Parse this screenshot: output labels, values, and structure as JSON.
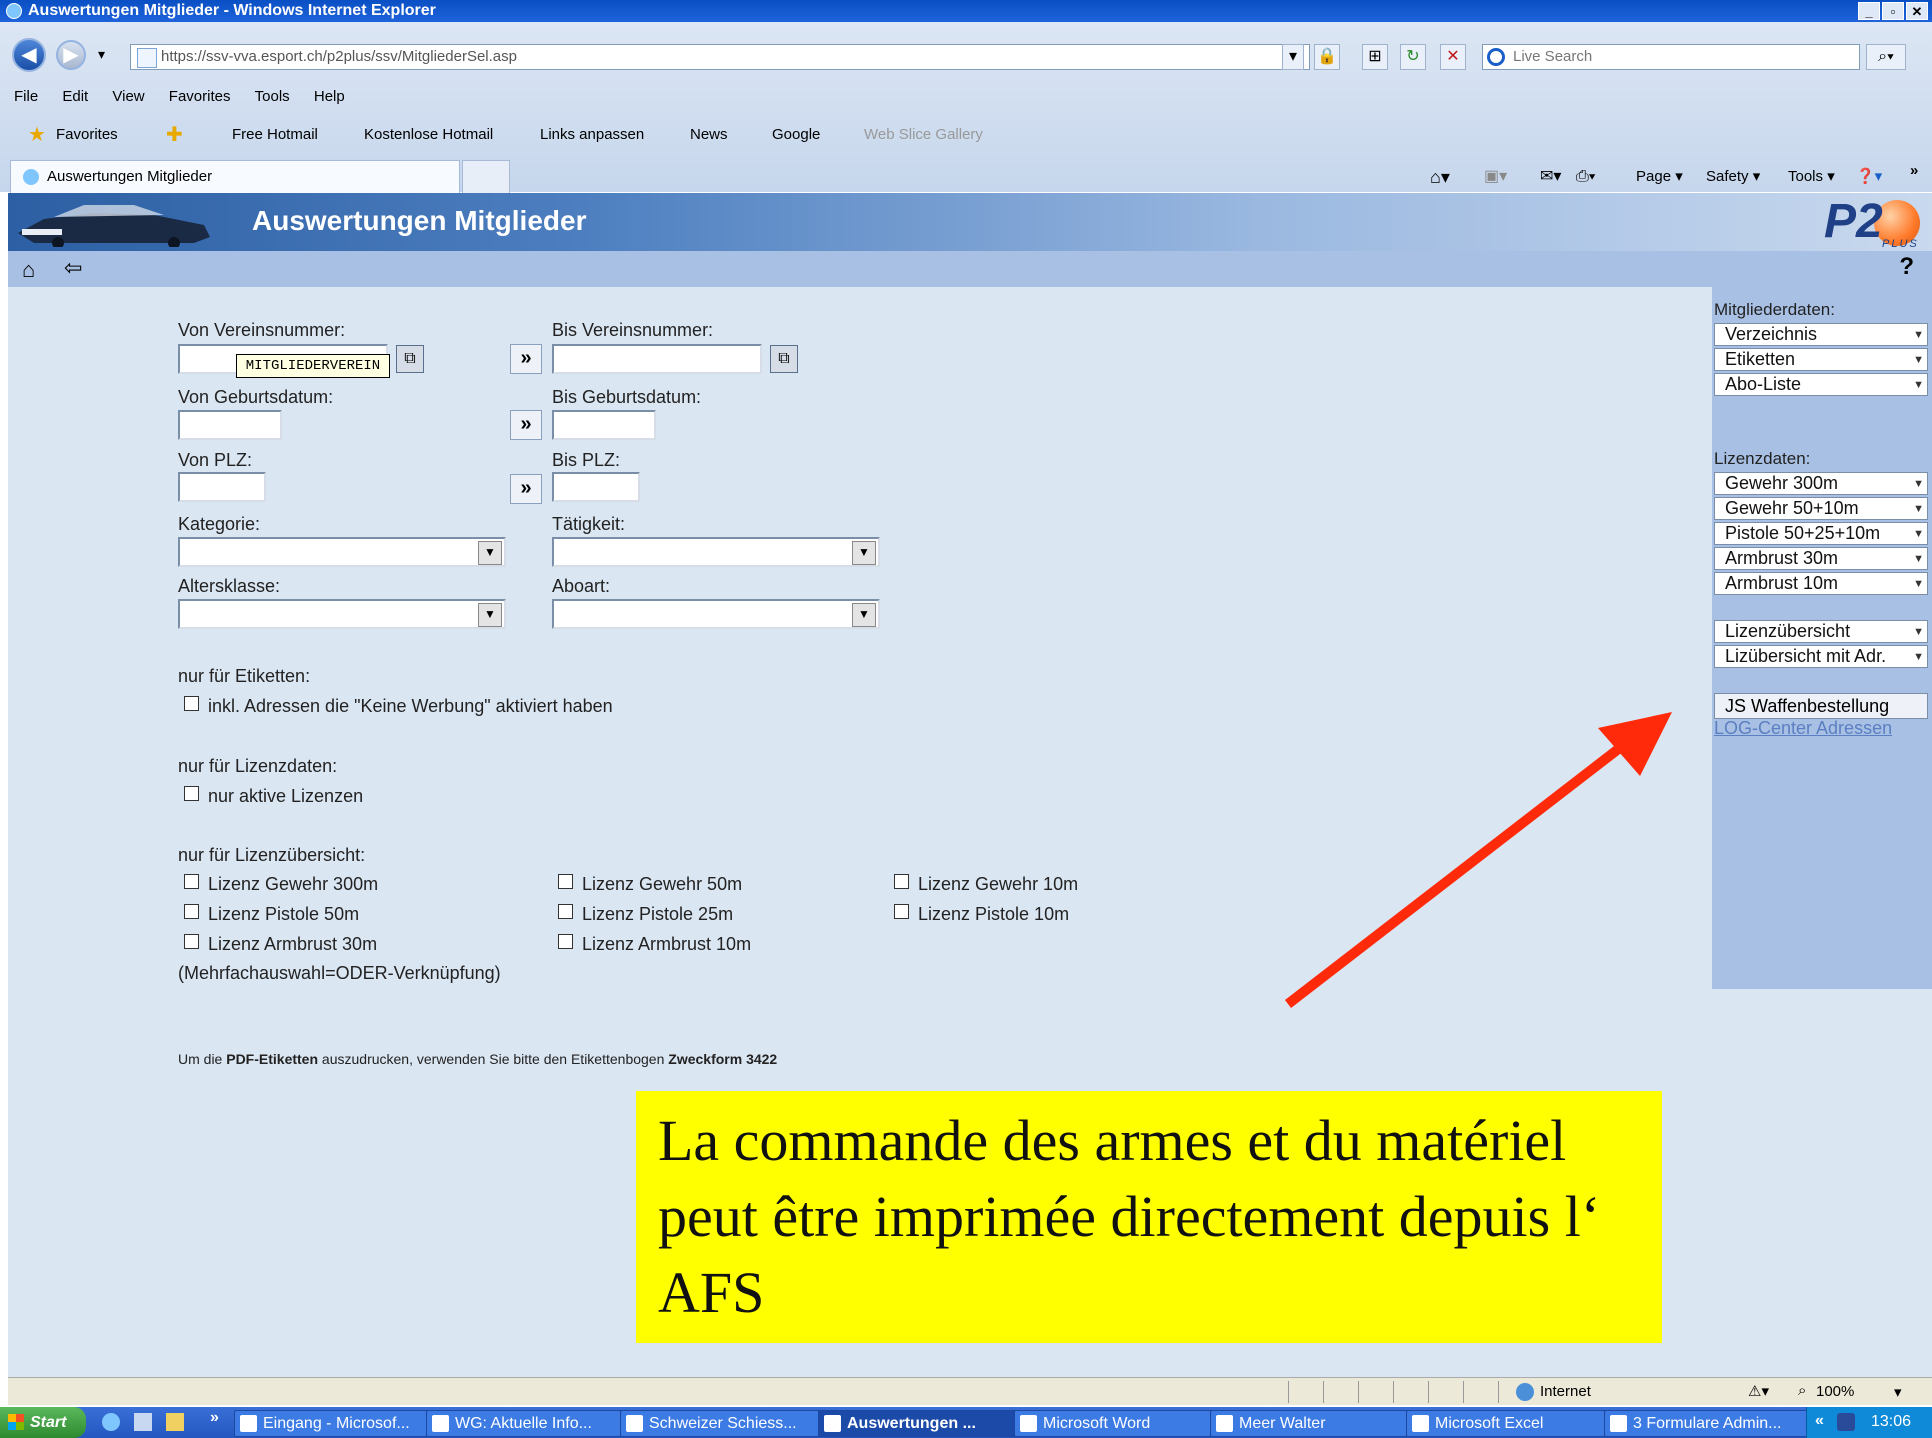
{
  "window": {
    "title": "Auswertungen Mitglieder - Windows Internet Explorer",
    "url": "https://ssv-vva.esport.ch/p2plus/ssv/MitgliederSel.asp",
    "search_placeholder": "Live Search",
    "menu": [
      "File",
      "Edit",
      "View",
      "Favorites",
      "Tools",
      "Help"
    ],
    "favorites_label": "Favorites",
    "favorites": [
      "Free Hotmail",
      "Kostenlose Hotmail",
      "Links anpassen",
      "News",
      "Google",
      "Web Slice Gallery"
    ],
    "tab_title": "Auswertungen Mitglieder",
    "commands": [
      "Page",
      "Safety",
      "Tools"
    ]
  },
  "page": {
    "title": "Auswertungen Mitglieder",
    "logo": "P2",
    "logo_sub": "PLUS",
    "help": "?"
  },
  "form": {
    "von_vereinsnummer": "Von Vereinsnummer:",
    "bis_vereinsnummer": "Bis Vereinsnummer:",
    "tooltip": "MITGLIEDERVEREIN",
    "von_geburtsdatum": "Von Geburtsdatum:",
    "bis_geburtsdatum": "Bis Geburtsdatum:",
    "von_plz": "Von PLZ:",
    "bis_plz": "Bis PLZ:",
    "kategorie": "Kategorie:",
    "taetigkeit": "Tätigkeit:",
    "altersklasse": "Altersklasse:",
    "aboart": "Aboart:",
    "go": "»",
    "nur_etiketten": "nur für Etiketten:",
    "inkl_adressen": "inkl. Adressen die \"Keine Werbung\" aktiviert haben",
    "nur_lizenzdaten": "nur für Lizenzdaten:",
    "nur_aktive": "nur aktive Lizenzen",
    "nur_lizenzuebersicht": "nur für Lizenzübersicht:",
    "lizenz": [
      [
        "Lizenz Gewehr 300m",
        "Lizenz Gewehr 50m",
        "Lizenz Gewehr 10m"
      ],
      [
        "Lizenz Pistole 50m",
        "Lizenz Pistole 25m",
        "Lizenz Pistole 10m"
      ],
      [
        "Lizenz Armbrust 30m",
        "Lizenz Armbrust 10m"
      ]
    ],
    "mehrfach": "(Mehrfachauswahl=ODER-Verknüpfung)",
    "pdf_note_1": "Um die ",
    "pdf_note_bold1": "PDF-Etiketten",
    "pdf_note_2": " auszudrucken, verwenden Sie bitte den Etikettenbogen ",
    "pdf_note_bold2": "Zweckform 3422"
  },
  "sidebar": {
    "mitgliederdaten": "Mitgliederdaten:",
    "mitglieder_items": [
      "Verzeichnis",
      "Etiketten",
      "Abo-Liste"
    ],
    "lizenzdaten": "Lizenzdaten:",
    "lizenz_items": [
      "Gewehr 300m",
      "Gewehr 50+10m",
      "Pistole 50+25+10m",
      "Armbrust 30m",
      "Armbrust 10m"
    ],
    "uebersicht_items": [
      "Lizenzübersicht",
      "Lizübersicht mit Adr."
    ],
    "waffen_button": "JS Waffenbestellung",
    "log_link": "LOG-Center Adressen"
  },
  "annotation": {
    "text": "La commande des armes et du matériel peut être imprimée directement depuis l‘ AFS",
    "background": "#ffff00",
    "arrow_color": "#ff2a0a"
  },
  "status": {
    "zone": "Internet",
    "zoom": "100%"
  },
  "taskbar": {
    "start": "Start",
    "tasks": [
      "Eingang - Microsof...",
      "WG: Aktuelle Info...",
      "Schweizer Schiess...",
      "Auswertungen ...",
      "Microsoft Word",
      "Meer Walter",
      "Microsoft Excel",
      "3 Formulare Admin..."
    ],
    "clock": "13:06"
  }
}
